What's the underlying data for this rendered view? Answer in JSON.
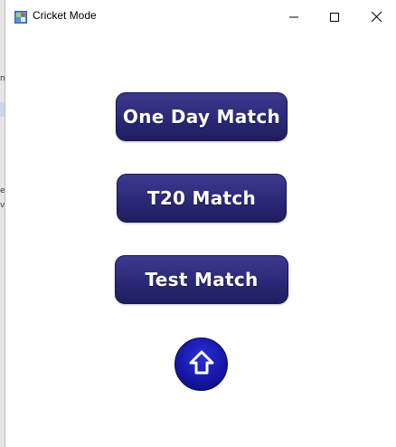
{
  "window": {
    "title": "Cricket Mode"
  },
  "buttons": {
    "one_day": "One Day Match",
    "t20": "T20 Match",
    "test": "Test Match"
  },
  "icons": {
    "app": "cricket-app-icon",
    "minimize": "minimize-icon",
    "maximize": "maximize-icon",
    "close": "close-icon",
    "home": "home-icon"
  },
  "colors": {
    "button_bg": "#2b2977",
    "home_bg": "#1717a8",
    "button_text": "#ffffff"
  }
}
